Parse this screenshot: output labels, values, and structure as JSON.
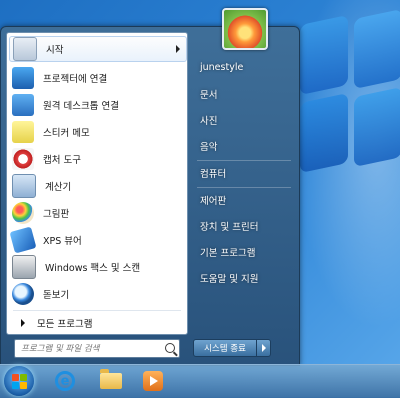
{
  "start_menu": {
    "programs": [
      {
        "label": "시작",
        "icon": "getting-started-icon",
        "has_submenu": true
      },
      {
        "label": "프로젝터에 연결",
        "icon": "projector-icon"
      },
      {
        "label": "원격 데스크톱 연결",
        "icon": "remote-desktop-icon"
      },
      {
        "label": "스티커 메모",
        "icon": "sticky-notes-icon"
      },
      {
        "label": "캡처 도구",
        "icon": "snipping-tool-icon"
      },
      {
        "label": "계산기",
        "icon": "calculator-icon"
      },
      {
        "label": "그림판",
        "icon": "paint-icon"
      },
      {
        "label": "XPS 뷰어",
        "icon": "xps-viewer-icon"
      },
      {
        "label": "Windows 팩스 및 스캔",
        "icon": "fax-scan-icon"
      },
      {
        "label": "돋보기",
        "icon": "magnifier-icon"
      }
    ],
    "all_programs": "모든 프로그램",
    "search_placeholder": "프로그램 및 파일 검색",
    "right_items": [
      "junestyle",
      "문서",
      "사진",
      "음악",
      "컴퓨터",
      "제어판",
      "장치 및 프린터",
      "기본 프로그램",
      "도움말 및 지원"
    ],
    "shutdown_label": "시스템 종료"
  },
  "taskbar": {
    "buttons": [
      "start-orb-icon",
      "internet-explorer-icon",
      "windows-explorer-icon",
      "media-player-icon"
    ]
  },
  "colors": {
    "desktop": "#2f86d8",
    "menu_frame": "#406e96",
    "selected_highlight": "#e9f2fc"
  }
}
